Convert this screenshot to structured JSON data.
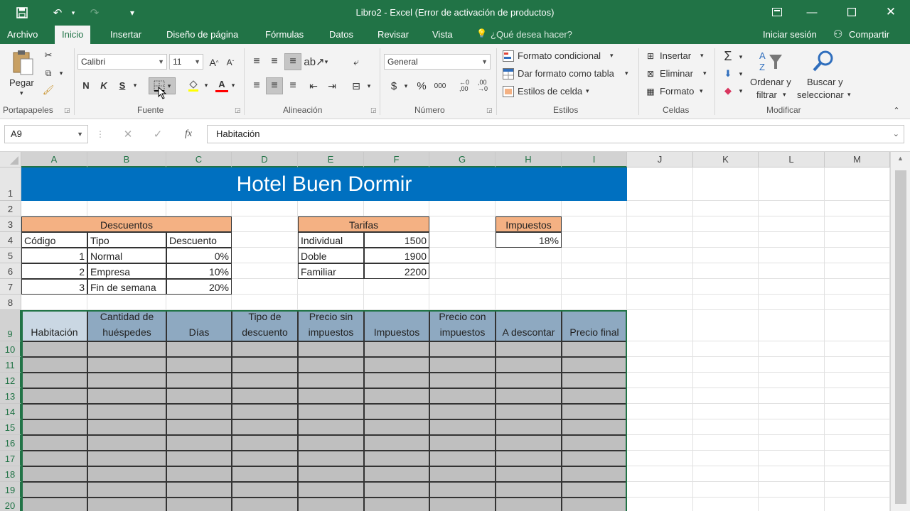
{
  "window": {
    "title": "Libro2 - Excel (Error de activación de productos)"
  },
  "tabs": [
    "Archivo",
    "Inicio",
    "Insertar",
    "Diseño de página",
    "Fórmulas",
    "Datos",
    "Revisar",
    "Vista"
  ],
  "tell_me": "¿Qué desea hacer?",
  "signin": "Iniciar sesión",
  "share": "Compartir",
  "ribbon": {
    "clipboard": {
      "paste": "Pegar",
      "label": "Portapapeles"
    },
    "font": {
      "name": "Calibri",
      "size": "11",
      "bold": "N",
      "italic": "K",
      "underline": "S",
      "label": "Fuente"
    },
    "alignment": {
      "label": "Alineación"
    },
    "number": {
      "format": "General",
      "currency": "$",
      "percent": "%",
      "thousands": "000",
      "label": "Número"
    },
    "styles": {
      "conditional": "Formato condicional",
      "table": "Dar formato como tabla",
      "cell": "Estilos de celda",
      "label": "Estilos"
    },
    "cells": {
      "insert": "Insertar",
      "delete": "Eliminar",
      "format": "Formato",
      "label": "Celdas"
    },
    "editing": {
      "sort1": "Ordenar y",
      "sort2": "filtrar",
      "find1": "Buscar y",
      "find2": "seleccionar",
      "label": "Modificar"
    }
  },
  "formula_bar": {
    "name_box": "A9",
    "content": "Habitación"
  },
  "columns": [
    "A",
    "B",
    "C",
    "D",
    "E",
    "F",
    "G",
    "H",
    "I",
    "J",
    "K",
    "L",
    "M"
  ],
  "rows": [
    "1",
    "2",
    "3",
    "4",
    "5",
    "6",
    "7",
    "8",
    "9",
    "10",
    "11",
    "12",
    "13",
    "14",
    "15",
    "16",
    "17",
    "18",
    "19",
    "20"
  ],
  "sheet": {
    "title": "Hotel Buen Dormir",
    "discounts": {
      "header": "Descuentos",
      "col_code": "Código",
      "col_type": "Tipo",
      "col_discount": "Descuento",
      "rows": [
        {
          "code": "1",
          "type": "Normal",
          "discount": "0%"
        },
        {
          "code": "2",
          "type": "Empresa",
          "discount": "10%"
        },
        {
          "code": "3",
          "type": "Fin de semana",
          "discount": "20%"
        }
      ]
    },
    "rates": {
      "header": "Tarifas",
      "rows": [
        {
          "name": "Individual",
          "price": "1500"
        },
        {
          "name": "Doble",
          "price": "1900"
        },
        {
          "name": "Familiar",
          "price": "2200"
        }
      ]
    },
    "taxes": {
      "header": "Impuestos",
      "value": "18%"
    },
    "main_headers": [
      [
        "Habitación"
      ],
      [
        "Cantidad de",
        "huéspedes"
      ],
      [
        "Días"
      ],
      [
        "Tipo de",
        "descuento"
      ],
      [
        "Precio sin",
        "impuestos"
      ],
      [
        "Impuestos"
      ],
      [
        "Precio con",
        "impuestos"
      ],
      [
        "A descontar"
      ],
      [
        "Precio final"
      ]
    ]
  },
  "colors": {
    "excel_green": "#217346",
    "title_fill": "#0070c0",
    "orange_fill": "#f4b183",
    "header_fill": "#8ea9c1",
    "body_fill": "#bfbfbf"
  }
}
